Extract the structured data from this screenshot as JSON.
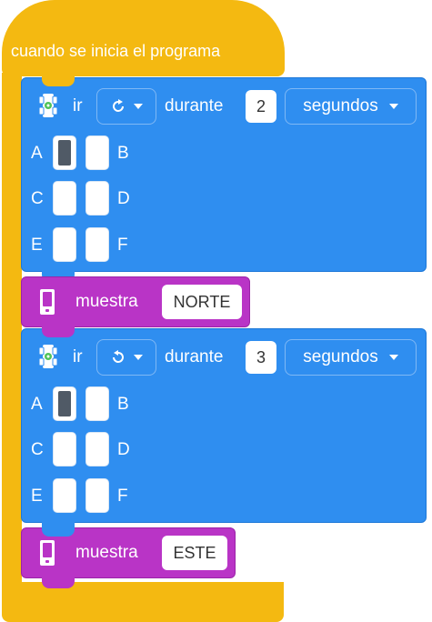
{
  "event": {
    "title": "cuando se inicia el programa"
  },
  "blocks": [
    {
      "type": "drive",
      "verb": "ir",
      "direction_icon": "rotate-clockwise-icon",
      "during": "durante",
      "value": "2",
      "unit": "segundos",
      "ports": {
        "A": "A",
        "B": "B",
        "C": "C",
        "D": "D",
        "E": "E",
        "F": "F",
        "selected": "A"
      }
    },
    {
      "type": "display",
      "label": "muestra",
      "value": "NORTE"
    },
    {
      "type": "drive",
      "verb": "ir",
      "direction_icon": "rotate-counterclockwise-icon",
      "during": "durante",
      "value": "3",
      "unit": "segundos",
      "ports": {
        "A": "A",
        "B": "B",
        "C": "C",
        "D": "D",
        "E": "E",
        "F": "F",
        "selected": "A"
      }
    },
    {
      "type": "display",
      "label": "muestra",
      "value": "ESTE"
    }
  ],
  "colors": {
    "event": "#f4b911",
    "drive": "#2f8ef0",
    "display": "#b934c6"
  }
}
